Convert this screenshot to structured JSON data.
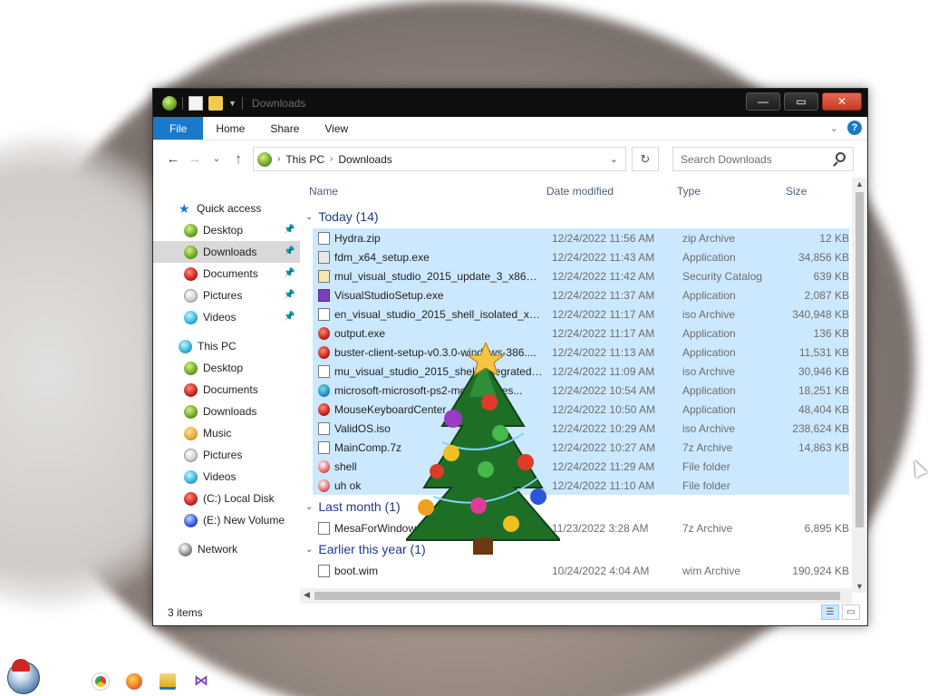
{
  "window": {
    "title": "Downloads",
    "buttons": {
      "minimize": "—",
      "maximize": "▭",
      "close": "✕"
    }
  },
  "ribbon": {
    "tabs": [
      "File",
      "Home",
      "Share",
      "View"
    ],
    "help": "?"
  },
  "address": {
    "segments": [
      "This PC",
      "Downloads"
    ],
    "search_placeholder": "Search Downloads"
  },
  "nav": {
    "quick_access": "Quick access",
    "quick_items": [
      {
        "label": "Desktop",
        "icon": "globe-green-icon",
        "pinned": true
      },
      {
        "label": "Downloads",
        "icon": "globe-green-icon",
        "pinned": true,
        "selected": true
      },
      {
        "label": "Documents",
        "icon": "globe-red-icon",
        "pinned": true
      },
      {
        "label": "Pictures",
        "icon": "globe-white-icon",
        "pinned": true
      },
      {
        "label": "Videos",
        "icon": "globe-cyan-icon",
        "pinned": true
      }
    ],
    "this_pc": "This PC",
    "pc_items": [
      {
        "label": "Desktop",
        "icon": "globe-green-icon"
      },
      {
        "label": "Documents",
        "icon": "globe-red-icon"
      },
      {
        "label": "Downloads",
        "icon": "globe-green-icon"
      },
      {
        "label": "Music",
        "icon": "globe-orange-icon"
      },
      {
        "label": "Pictures",
        "icon": "globe-white-icon"
      },
      {
        "label": "Videos",
        "icon": "globe-cyan-icon"
      },
      {
        "label": "(C:) Local Disk",
        "icon": "globe-red-icon"
      },
      {
        "label": "(E:) New Volume",
        "icon": "globe-blue-icon"
      }
    ],
    "network": "Network"
  },
  "columns": {
    "name": "Name",
    "date": "Date modified",
    "type": "Type",
    "size": "Size"
  },
  "groups": [
    {
      "title": "Today (14)",
      "files": [
        {
          "name": "Hydra.zip",
          "date": "12/24/2022 11:56 AM",
          "type": "zip Archive",
          "size": "12 KB",
          "icon": "zip-icon"
        },
        {
          "name": "fdm_x64_setup.exe",
          "date": "12/24/2022 11:43 AM",
          "type": "Application",
          "size": "34,856 KB",
          "icon": "exe-icon"
        },
        {
          "name": "mul_visual_studio_2015_update_3_x86_x6...",
          "date": "12/24/2022 11:42 AM",
          "type": "Security Catalog",
          "size": "639 KB",
          "icon": "catalog-icon"
        },
        {
          "name": "VisualStudioSetup.exe",
          "date": "12/24/2022 11:37 AM",
          "type": "Application",
          "size": "2,087 KB",
          "icon": "visual-studio-icon"
        },
        {
          "name": "en_visual_studio_2015_shell_isolated_x86...",
          "date": "12/24/2022 11:17 AM",
          "type": "iso Archive",
          "size": "340,948 KB",
          "icon": "iso-icon"
        },
        {
          "name": "output.exe",
          "date": "12/24/2022 11:17 AM",
          "type": "Application",
          "size": "136 KB",
          "icon": "app-icon"
        },
        {
          "name": "buster-client-setup-v0.3.0-windows-386....",
          "date": "12/24/2022 11:13 AM",
          "type": "Application",
          "size": "11,531 KB",
          "icon": "app-icon"
        },
        {
          "name": "mu_visual_studio_2015_shell_integrated_...",
          "date": "12/24/2022 11:09 AM",
          "type": "iso Archive",
          "size": "30,946 KB",
          "icon": "iso-icon"
        },
        {
          "name": "microsoft-microsoft-ps2-mouse-bytes...",
          "date": "12/24/2022 10:54 AM",
          "type": "Application",
          "size": "18,251 KB",
          "icon": "edge-icon"
        },
        {
          "name": "MouseKeyboardCenter...",
          "date": "12/24/2022 10:50 AM",
          "type": "Application",
          "size": "48,404 KB",
          "icon": "app-icon"
        },
        {
          "name": "ValidOS.iso",
          "date": "12/24/2022 10:29 AM",
          "type": "iso Archive",
          "size": "238,624 KB",
          "icon": "iso-icon"
        },
        {
          "name": "MainComp.7z",
          "date": "12/24/2022 10:27 AM",
          "type": "7z Archive",
          "size": "14,863 KB",
          "icon": "zip-icon"
        },
        {
          "name": "shell",
          "date": "12/24/2022 11:29 AM",
          "type": "File folder",
          "size": "",
          "icon": "folder-icon"
        },
        {
          "name": "uh ok",
          "date": "12/24/2022 11:10 AM",
          "type": "File folder",
          "size": "",
          "icon": "folder-icon"
        }
      ]
    },
    {
      "title": "Last month (1)",
      "files": [
        {
          "name": "MesaForWindows-x64...",
          "date": "11/23/2022 3:28 AM",
          "type": "7z Archive",
          "size": "6,895 KB",
          "icon": "zip-icon"
        }
      ]
    },
    {
      "title": "Earlier this year (1)",
      "files": [
        {
          "name": "boot.wim",
          "date": "10/24/2022 4:04 AM",
          "type": "wim Archive",
          "size": "190,924 KB",
          "icon": "wim-icon"
        }
      ]
    }
  ],
  "status": {
    "count": "3 items"
  },
  "colors": {
    "accent": "#1979ca",
    "selection": "#cce8ff",
    "group_text": "#1e3a8a"
  }
}
